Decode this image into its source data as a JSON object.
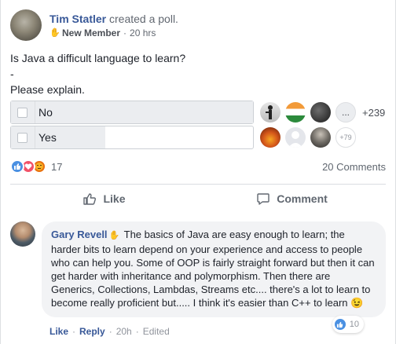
{
  "post": {
    "author": "Tim Statler",
    "action": "created a poll.",
    "badge": "New Member",
    "time": "20 hrs",
    "question": "Is Java a difficult language to learn?",
    "dash": "-",
    "explain": "Please explain."
  },
  "poll": {
    "options": [
      {
        "label": "No",
        "fill_fraction": 1.0,
        "extra_votes": "+239",
        "more_glyph": "..."
      },
      {
        "label": "Yes",
        "fill_fraction": 0.39,
        "overflow_badge": "+79"
      }
    ]
  },
  "reactions": {
    "count": "17",
    "types": [
      "like-icon",
      "love-icon",
      "angry-icon"
    ],
    "comments_label": "20 Comments"
  },
  "actions": {
    "like_label": "Like",
    "comment_label": "Comment"
  },
  "comment": {
    "author": "Gary Revell",
    "text": "The basics of Java are easy enough to learn; the harder bits to learn depend on your experience and access to people who can help you. Some of OOP is fairly straight forward but then it can get harder with inheritance and polymorphism. Then there are Generics, Collections, Lambdas, Streams etc.... there's a lot to learn to become really proficient but..... I think it's easier than C++ to learn",
    "emoji": "😉",
    "like_label": "Like",
    "reply_label": "Reply",
    "time": "20h",
    "edited": "Edited",
    "reaction_count": "10"
  },
  "colors": {
    "link": "#385898",
    "like_blue": "#4a90e2",
    "love_red": "#f25268",
    "angry_orange": "#e9710f"
  }
}
